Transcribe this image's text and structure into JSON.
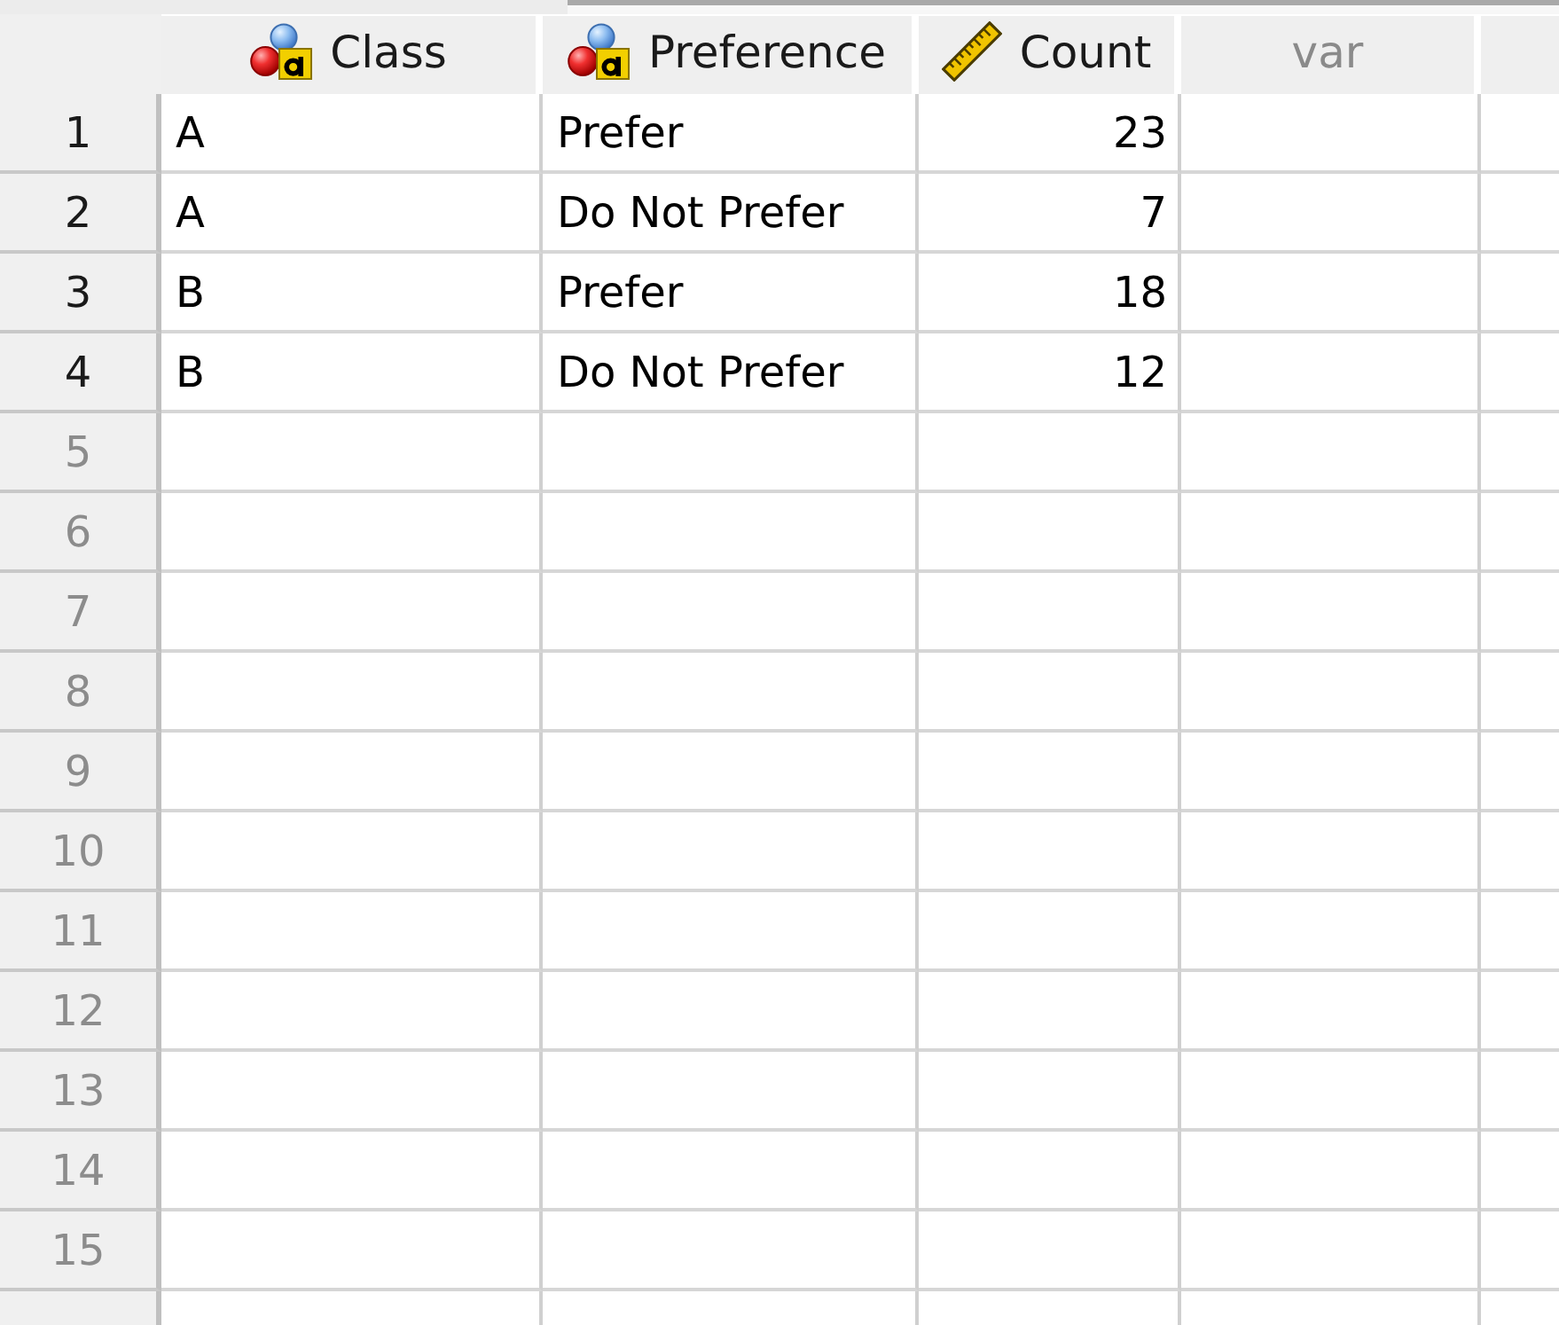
{
  "columns": [
    {
      "label": "Class",
      "kind": "nominal"
    },
    {
      "label": "Preference",
      "kind": "nominal"
    },
    {
      "label": "Count",
      "kind": "scale"
    },
    {
      "label": "var",
      "kind": "placeholder"
    }
  ],
  "rows": [
    {
      "number": "1",
      "empty": false,
      "cells": [
        "A",
        "Prefer",
        "23"
      ]
    },
    {
      "number": "2",
      "empty": false,
      "cells": [
        "A",
        "Do Not Prefer",
        "7"
      ]
    },
    {
      "number": "3",
      "empty": false,
      "cells": [
        "B",
        "Prefer",
        "18"
      ]
    },
    {
      "number": "4",
      "empty": false,
      "cells": [
        "B",
        "Do Not Prefer",
        "12"
      ]
    },
    {
      "number": "5",
      "empty": true
    },
    {
      "number": "6",
      "empty": true
    },
    {
      "number": "7",
      "empty": true
    },
    {
      "number": "8",
      "empty": true
    },
    {
      "number": "9",
      "empty": true
    },
    {
      "number": "10",
      "empty": true
    },
    {
      "number": "11",
      "empty": true
    },
    {
      "number": "12",
      "empty": true
    },
    {
      "number": "13",
      "empty": true
    },
    {
      "number": "14",
      "empty": true
    },
    {
      "number": "15",
      "empty": true
    }
  ]
}
